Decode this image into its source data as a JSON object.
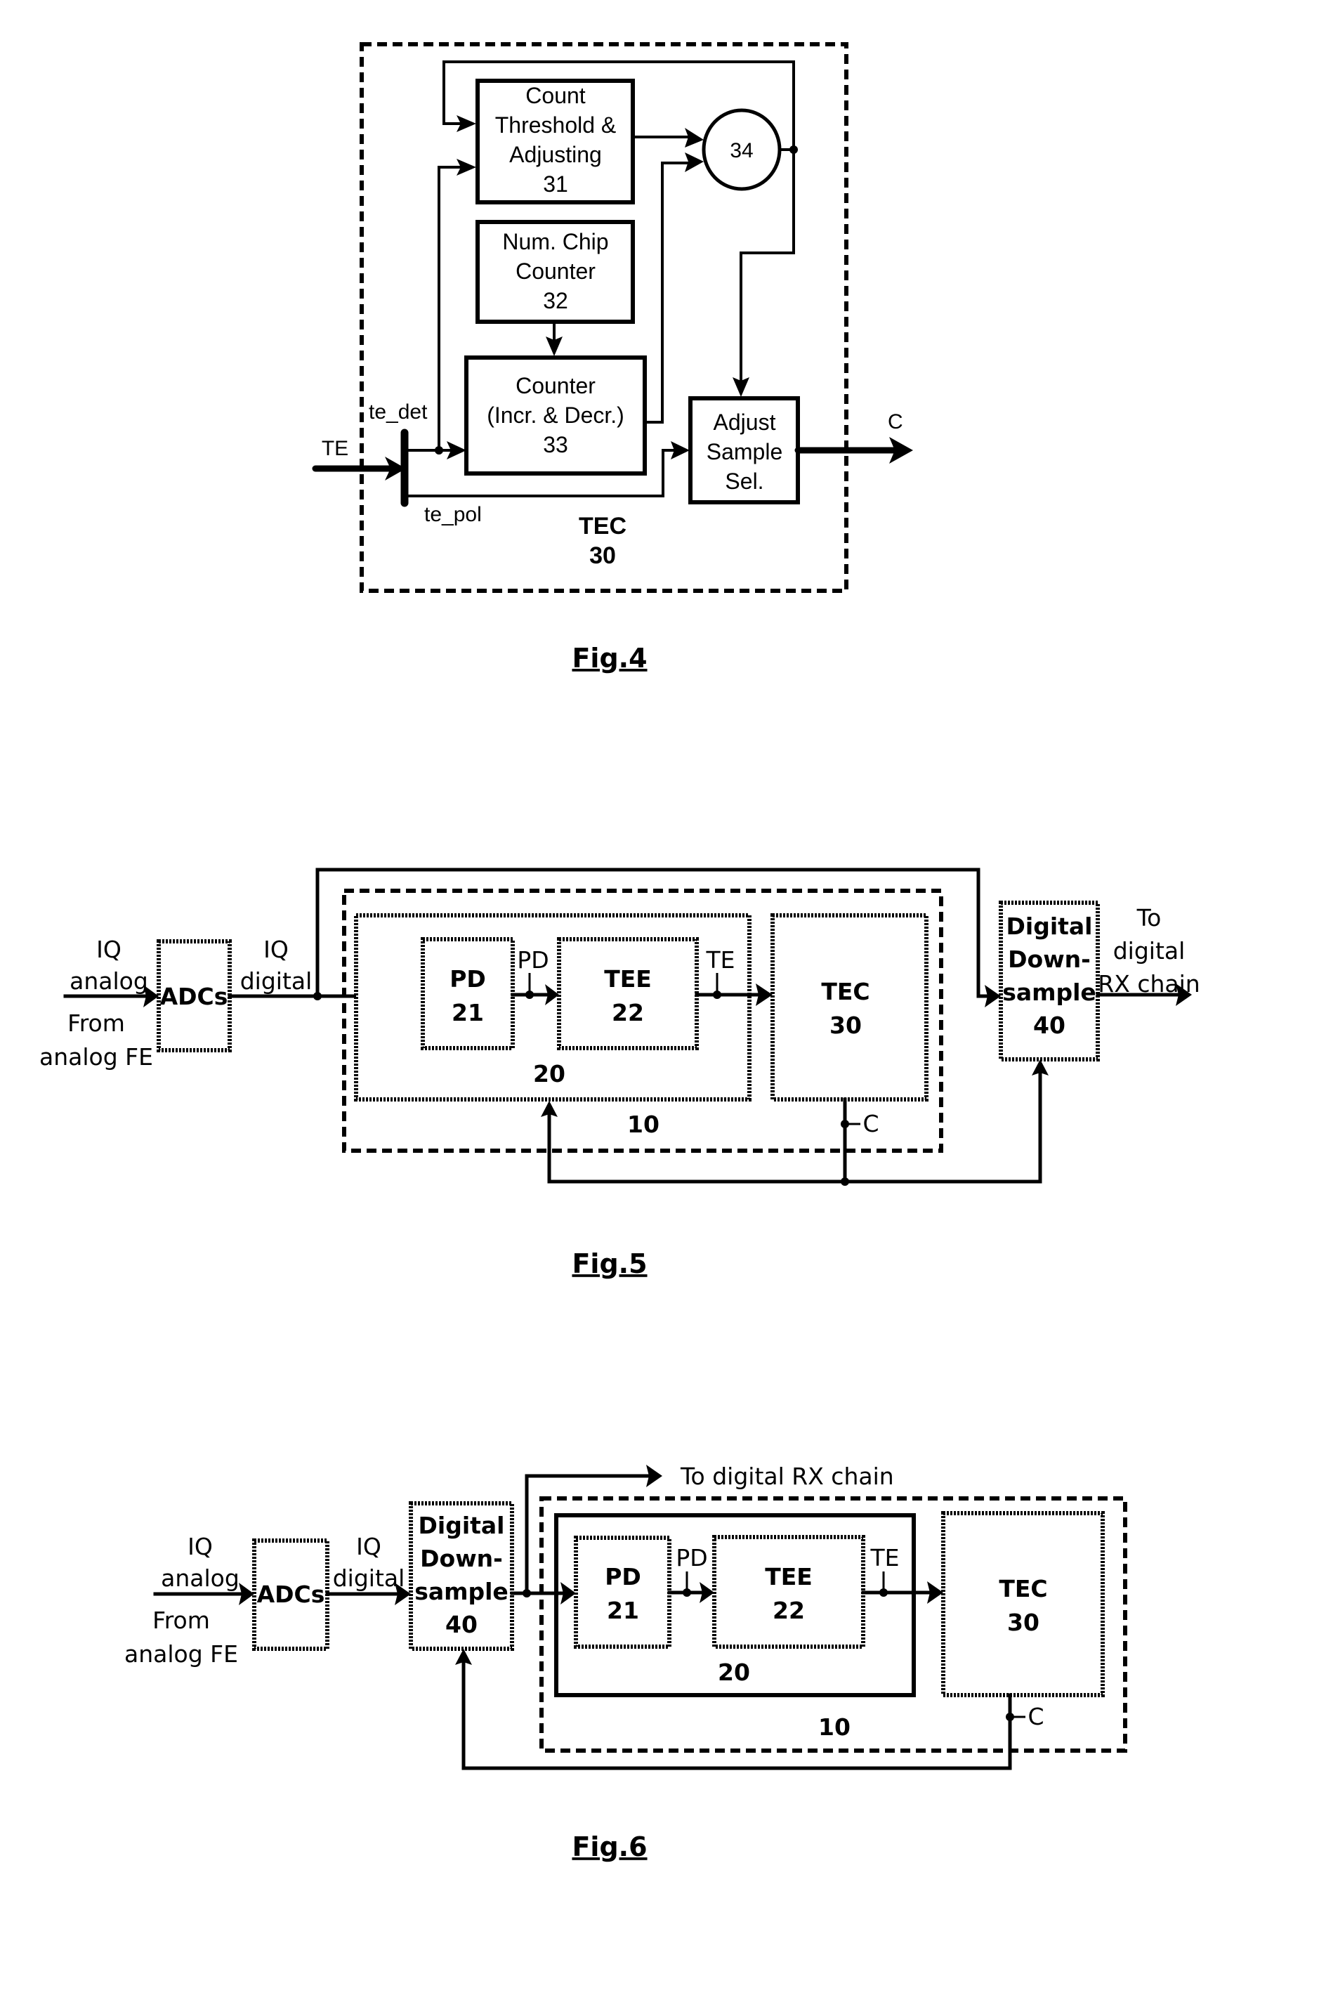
{
  "fig4": {
    "caption": "Fig.4",
    "container": {
      "title": "TEC",
      "number": "30"
    },
    "blocks": {
      "count_threshold": {
        "lines": [
          "Count",
          "Threshold &",
          "Adjusting",
          "31"
        ]
      },
      "num_chip_counter": {
        "lines": [
          "Num. Chip",
          "Counter",
          "32"
        ]
      },
      "counter": {
        "lines": [
          "Counter",
          "(Incr. & Decr.)",
          "33"
        ]
      },
      "adjust_sample": {
        "lines": [
          "Adjust",
          "Sample",
          "Sel."
        ]
      },
      "combiner": {
        "label": "34"
      }
    },
    "signals": {
      "input": "TE",
      "te_det": "te_det",
      "te_pol": "te_pol",
      "output": "C"
    }
  },
  "fig5": {
    "caption": "Fig.5",
    "input_labels": {
      "top": [
        "IQ",
        "analog"
      ],
      "bottom": [
        "From",
        "analog FE"
      ]
    },
    "adc": {
      "label": "ADCs"
    },
    "digital_label": [
      "IQ",
      "digital"
    ],
    "outer": {
      "number": "10"
    },
    "inner": {
      "number": "20"
    },
    "pd": {
      "title": "PD",
      "number": "21"
    },
    "tee": {
      "title": "TEE",
      "number": "22"
    },
    "tec": {
      "title": "TEC",
      "number": "30"
    },
    "dds": {
      "lines": [
        "Digital",
        "Down-",
        "sample",
        "40"
      ]
    },
    "signals": {
      "pd": "PD",
      "te": "TE",
      "c": "C"
    },
    "output_label": [
      "To",
      "digital",
      "RX chain"
    ]
  },
  "fig6": {
    "caption": "Fig.6",
    "input_labels": {
      "top": [
        "IQ",
        "analog"
      ],
      "bottom": [
        "From",
        "analog FE"
      ]
    },
    "adc": {
      "label": "ADCs"
    },
    "digital_label": [
      "IQ",
      "digital"
    ],
    "dds": {
      "lines": [
        "Digital",
        "Down-",
        "sample",
        "40"
      ]
    },
    "output_label": "To digital RX chain",
    "outer": {
      "number": "10"
    },
    "inner": {
      "number": "20"
    },
    "pd": {
      "title": "PD",
      "number": "21"
    },
    "tee": {
      "title": "TEE",
      "number": "22"
    },
    "tec": {
      "title": "TEC",
      "number": "30"
    },
    "signals": {
      "pd": "PD",
      "te": "TE",
      "c": "C"
    }
  }
}
